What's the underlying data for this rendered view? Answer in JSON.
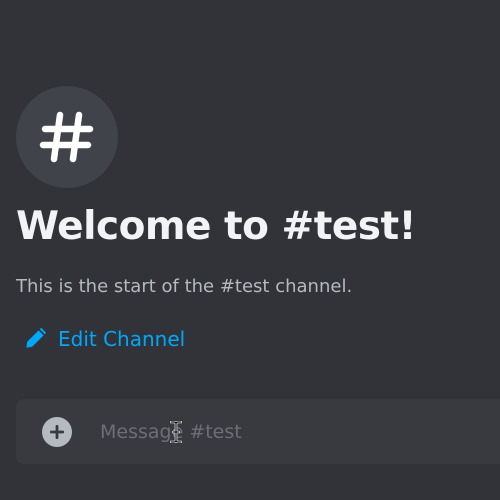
{
  "channel": {
    "name": "#test",
    "avatar_icon": "hashtag-icon"
  },
  "welcome": {
    "title": "Welcome to #test!",
    "subtitle": "This is the start of the #test channel."
  },
  "edit_channel": {
    "icon": "pencil-icon",
    "label": "Edit Channel"
  },
  "composer": {
    "add_icon": "plus-circle-icon",
    "placeholder": "Message #test",
    "value": ""
  },
  "colors": {
    "background": "#313338",
    "composer_background": "#383a40",
    "link": "#00a8fc",
    "avatar_background": "#41434a",
    "title_text": "#f2f3f5",
    "muted_text": "#b5bac1",
    "placeholder_text": "#6d6f78"
  }
}
